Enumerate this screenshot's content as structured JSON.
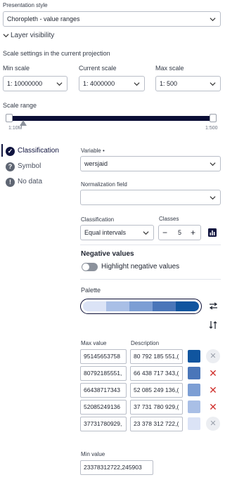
{
  "presentation_style": {
    "label": "Presentation style",
    "value": "Choropleth - value ranges"
  },
  "layer_visibility": {
    "label": "Layer visibility"
  },
  "scale_settings": {
    "title": "Scale settings in the current projection",
    "min_label": "Min scale",
    "min_prefix": "1:",
    "min_value": "10000000",
    "current_label": "Current scale",
    "current_prefix": "1:",
    "current_value": "4000000",
    "max_label": "Max scale",
    "max_prefix": "1:",
    "max_value": "500"
  },
  "scale_range": {
    "label": "Scale range",
    "left_tick": "1:10M",
    "right_tick": "1:500"
  },
  "nav": {
    "classification": "Classification",
    "symbol": "Symbol",
    "no_data": "No data"
  },
  "variable": {
    "label": "Variable •",
    "value": "wersjaid"
  },
  "normalization": {
    "label": "Normalization field",
    "value": ""
  },
  "classification": {
    "label": "Classification",
    "value": "Equal intervals"
  },
  "classes": {
    "label": "Classes",
    "value": "5",
    "minus": "−",
    "plus": "+"
  },
  "negative_values": {
    "title": "Negative values",
    "toggle_label": "Highlight negative values",
    "enabled": false
  },
  "palette": {
    "label": "Palette",
    "colors": [
      "#dbe3f6",
      "#a9bfe6",
      "#7c9ed4",
      "#4a76b9",
      "#10559f"
    ]
  },
  "ranges": {
    "max_label": "Max value",
    "desc_label": "Description",
    "rows": [
      {
        "max": "95145653758",
        "desc": "80 792 185 551,(",
        "color": "#10559f",
        "removable": false
      },
      {
        "max": "80792185551,",
        "desc": "66 438 717 343,(",
        "color": "#4a76b9",
        "removable": true
      },
      {
        "max": "66438717343",
        "desc": "52 085 249 136,(",
        "color": "#7c9ed4",
        "removable": true
      },
      {
        "max": "52085249136",
        "desc": "37 731 780 929,(",
        "color": "#a9bfe6",
        "removable": true
      },
      {
        "max": "37731780929,",
        "desc": "23 378 312 722,(",
        "color": "#dbe3f6",
        "removable": false
      }
    ],
    "min_label": "Min value",
    "min_value": "23378312722,245903"
  }
}
